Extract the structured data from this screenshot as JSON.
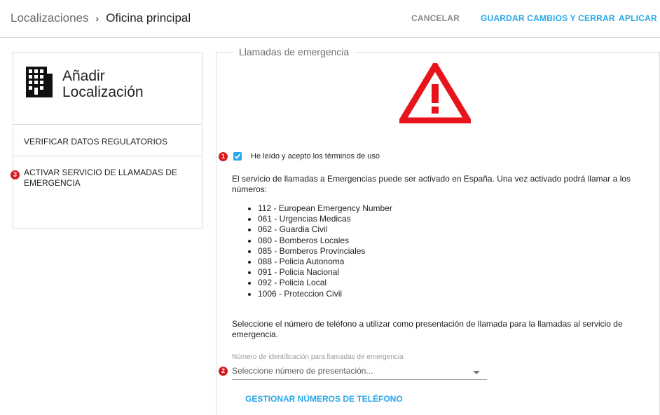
{
  "header": {
    "breadcrumb_parent": "Localizaciones",
    "breadcrumb_sep": "›",
    "breadcrumb_current": "Oficina principal",
    "cancel_label": "CANCELAR",
    "save_close_label": "GUARDAR CAMBIOS Y CERRAR",
    "apply_label": "APLICAR"
  },
  "sidebar": {
    "icon": "building-icon",
    "title_line1": "Añadir",
    "title_line2": "Localización",
    "items": [
      {
        "label": "VERIFICAR DATOS REGULATORIOS"
      },
      {
        "label": "ACTIVAR SERVICIO DE LLAMADAS DE EMERGENCIA",
        "badge": "3"
      }
    ]
  },
  "main": {
    "legend": "Llamadas de emergencia",
    "warning_icon": "warning-triangle-icon",
    "terms": {
      "badge": "1",
      "checked": true,
      "label": "He leído y acepto los términos de uso"
    },
    "intro_text": "El servicio de llamadas a Emergencias puede ser activado en España. Una vez activado podrá llamar a los números:",
    "numbers": [
      "112 - European Emergency Number",
      "061 - Urgencias Medicas",
      "062 - Guardia Civil",
      "080 - Bomberos Locales",
      "085 - Bomberos Provinciales",
      "088 - Policia Autonoma",
      "091 - Policia Nacional",
      "092 - Policia Local",
      "1006 - Proteccion Civil"
    ],
    "select_instruction": "Seleccione el número de teléfono a utilizar como presentación de llamada para la llamadas al servicio de emergencia.",
    "select": {
      "badge": "2",
      "label": "Número de identificación para llamadas de emergencia",
      "placeholder": "Seleccione número de presentación..."
    },
    "manage_label": "GESTIONAR NÚMEROS DE TELÉFONO"
  },
  "colors": {
    "accent": "#29a7e8",
    "warning": "#e8141c",
    "badge": "#d7191c"
  }
}
